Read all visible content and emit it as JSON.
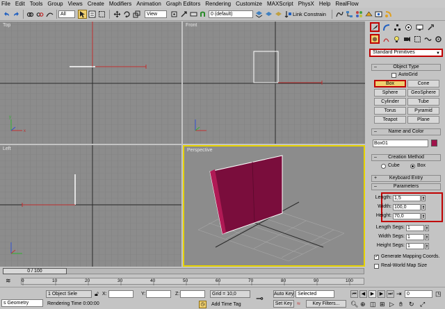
{
  "menu": [
    "File",
    "Edit",
    "Tools",
    "Group",
    "Views",
    "Create",
    "Modifiers",
    "Animation",
    "Graph Editors",
    "Rendering",
    "Customize",
    "MAXScript",
    "PhysX",
    "Help",
    "RealFlow"
  ],
  "toolbar": {
    "layer_value": "0 (default)",
    "link_constraint": "Link Constrain"
  },
  "viewports": {
    "top": "Top",
    "front": "Front",
    "left": "Left",
    "perspective": "Perspective"
  },
  "panel": {
    "dropdown": "Standard Primitives",
    "object_type": {
      "header": "Object Type",
      "autogrid": "AutoGrid",
      "buttons": [
        "Box",
        "Cone",
        "Sphere",
        "GeoSphere",
        "Cylinder",
        "Tube",
        "Torus",
        "Pyramid",
        "Teapot",
        "Plane"
      ]
    },
    "name_color": {
      "header": "Name and Color",
      "name": "Box01",
      "color": "#a0124a"
    },
    "creation_method": {
      "header": "Creation Method",
      "options": [
        "Cube",
        "Box"
      ],
      "selected": "Box"
    },
    "keyboard_entry": "Keyboard Entry",
    "parameters": {
      "header": "Parameters",
      "length_label": "Length:",
      "length": "1,5",
      "width_label": "Width:",
      "width": "100,0",
      "height_label": "Height:",
      "height": "70,0",
      "length_segs_label": "Length Segs:",
      "length_segs": "1",
      "width_segs_label": "Width Segs:",
      "width_segs": "1",
      "height_segs_label": "Height Segs:",
      "height_segs": "1",
      "gen_mapping": "Generate Mapping Coords.",
      "realworld": "Real-World Map Size"
    }
  },
  "timeline": {
    "frame": "0 / 100",
    "ticks": [
      "0",
      "10",
      "20",
      "30",
      "40",
      "50",
      "60",
      "70",
      "80",
      "90",
      "100"
    ]
  },
  "status": {
    "script": "s Geometry",
    "selection": "1 Object Sele",
    "rendering_time": "Rendering Time  0:00:00",
    "x_label": "X:",
    "y_label": "Y:",
    "z_label": "Z:",
    "grid": "Grid = 10,0",
    "add_time_tag": "Add Time Tag",
    "auto_key": "Auto Key",
    "set_key": "Set Key",
    "selected": "Selected",
    "key_filters": "Key Filters...",
    "frame_value": "0"
  }
}
